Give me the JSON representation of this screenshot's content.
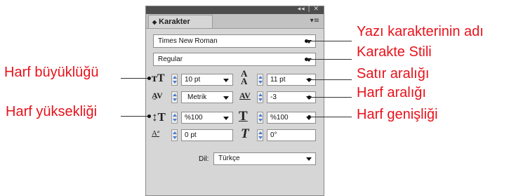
{
  "panel": {
    "title_bar": {
      "controls": "◂◂ | ✕"
    },
    "tab_label": "Karakter",
    "menu_icon": "panel-menu-icon",
    "font_family": "Times New Roman",
    "font_style": "Regular",
    "font_size": "10 pt",
    "leading": "11 pt",
    "kerning": "Metrik",
    "tracking": "-3",
    "vertical_scale": "%100",
    "horizontal_scale": "%100",
    "baseline_shift": "0 pt",
    "skew": "0°",
    "language_label": "Dil:",
    "language": "Türkçe"
  },
  "callouts": {
    "font_name": "Yazı karakterinin adı",
    "font_style": "Karakte Stili",
    "font_size": "Harf büyüklüğü",
    "leading": "Satır aralığı",
    "tracking": "Harf aralığı",
    "vertical_scale": "Harf yüksekliği",
    "horizontal_scale": "Harf genişliği"
  },
  "colors": {
    "callout": "#e8121b",
    "stepper_arrow": "#4a7bd0",
    "panel_bg": "#d6d6d6"
  }
}
